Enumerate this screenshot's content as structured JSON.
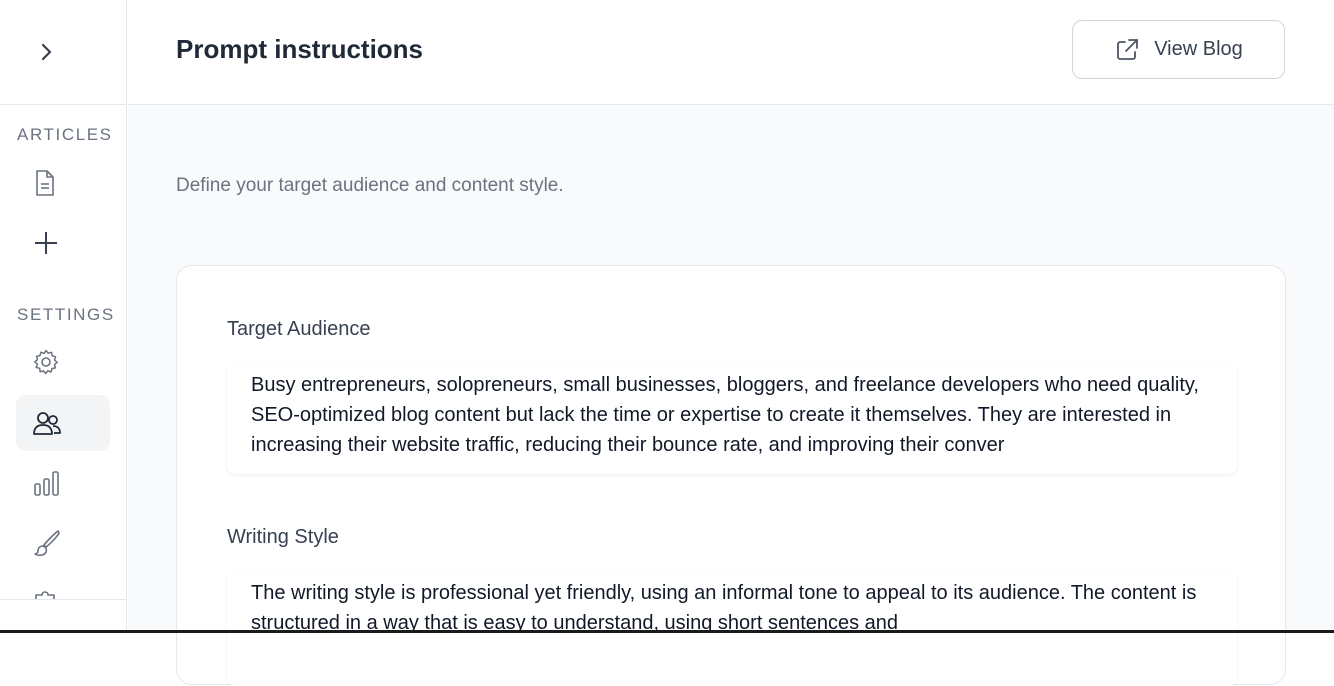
{
  "sidebar": {
    "toggle_icon": "chevron-right-icon",
    "sections": [
      {
        "label": "ARTICLES",
        "items": [
          {
            "icon": "document-icon"
          },
          {
            "icon": "plus-icon"
          }
        ]
      },
      {
        "label": "SETTINGS",
        "items": [
          {
            "icon": "gear-icon"
          },
          {
            "icon": "users-icon",
            "active": true
          },
          {
            "icon": "bar-chart-icon"
          },
          {
            "icon": "paintbrush-icon"
          },
          {
            "icon": "puzzle-icon"
          }
        ]
      }
    ]
  },
  "header": {
    "title": "Prompt instructions",
    "view_blog": {
      "label": "View Blog",
      "icon": "external-link-icon"
    }
  },
  "main": {
    "subtitle": "Define your target audience and content style.",
    "fields": [
      {
        "label": "Target Audience",
        "value": "Busy entrepreneurs, solopreneurs, small businesses, bloggers, and freelance developers who need quality, SEO-optimized blog content but lack the time or expertise to create it themselves. They are interested in increasing their website traffic, reducing their bounce rate, and improving their conver"
      },
      {
        "label": "Writing Style",
        "value": "The writing style is professional yet friendly, using an informal tone to appeal to its audience. The content is structured in a way that is easy to understand, using short sentences and"
      }
    ]
  },
  "colors": {
    "active_bg": "#f3f4f6",
    "border": "#e5e7eb",
    "page_bg": "#f9fafb"
  }
}
